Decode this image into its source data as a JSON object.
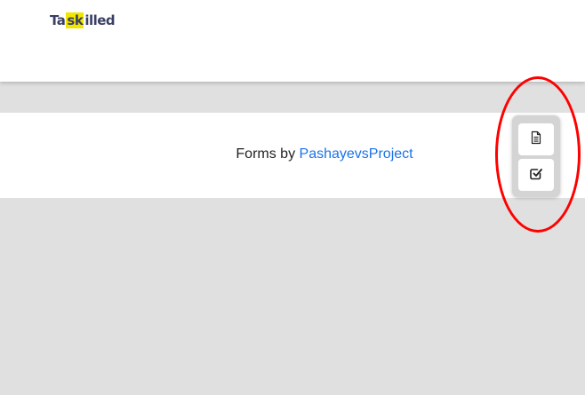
{
  "header": {
    "logo": {
      "prefix": "Ta",
      "highlight": "sk",
      "suffix": "illed"
    }
  },
  "footer": {
    "credit_prefix": "Forms by ",
    "credit_link": "PashayevsProject"
  },
  "toolbar": {
    "items": [
      {
        "icon": "document-icon"
      },
      {
        "icon": "checkbox-checked-icon"
      }
    ]
  },
  "colors": {
    "background": "#e0e0e0",
    "surface": "#ffffff",
    "link": "#1a73e8",
    "logo_highlight": "#f1e600",
    "logo_text": "#3a3f63",
    "annotation": "#ff0000"
  }
}
